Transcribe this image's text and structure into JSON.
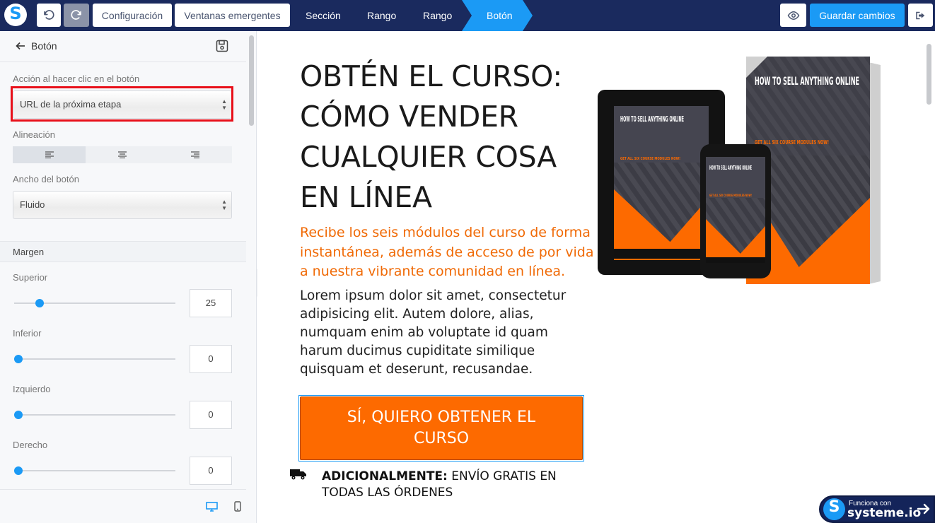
{
  "topbar": {
    "logo_letter": "S",
    "buttons": {
      "configuracion": "Configuración",
      "ventanas": "Ventanas emergentes"
    },
    "breadcrumbs": [
      "Sección",
      "Rango",
      "Rango",
      "Botón"
    ],
    "save_label": "Guardar cambios"
  },
  "sidebar": {
    "title": "Botón",
    "click_action_label": "Acción al hacer clic en el botón",
    "click_action_value": "URL de la próxima etapa",
    "alignment_label": "Alineación",
    "width_label": "Ancho del botón",
    "width_value": "Fluido",
    "margin_section": "Margen",
    "margins": [
      {
        "label": "Superior",
        "value": "25",
        "slider_fraction": 0.13
      },
      {
        "label": "Inferior",
        "value": "0",
        "slider_fraction": 0
      },
      {
        "label": "Izquierdo",
        "value": "0",
        "slider_fraction": 0
      },
      {
        "label": "Derecho",
        "value": "0",
        "slider_fraction": 0
      }
    ]
  },
  "page": {
    "headline": "OBTÉN EL CURSO: CÓMO VENDER CUALQUIER COSA EN LÍNEA",
    "subheadline": "Recibe los seis módulos del curso de forma instantánea, además de acceso de por vida a nuestra vibrante comunidad en línea.",
    "body": "Lorem ipsum dolor sit amet, consectetur adipisicing elit. Autem dolore, alias, numquam enim ab voluptate id quam harum ducimus cupiditate similique quisquam et deserunt, recusandae.",
    "cta_label": "SÍ, QUIERO OBTENER EL CURSO",
    "extra_bold": "ADICIONALMENTE:",
    "extra_rest": " ENVÍO GRATIS EN TODAS LAS ÓRDENES",
    "mockup": {
      "title": "HOW TO SELL ANYTHING ONLINE",
      "tagline": "GET ALL SIX COURSE MODULES NOW!"
    }
  },
  "badge": {
    "small": "Funciona con",
    "big": "systeme.io"
  },
  "colors": {
    "navy": "#1a2a5e",
    "accent": "#1b9af5",
    "orange": "#fd6a00",
    "highlight": "#e8101a"
  }
}
